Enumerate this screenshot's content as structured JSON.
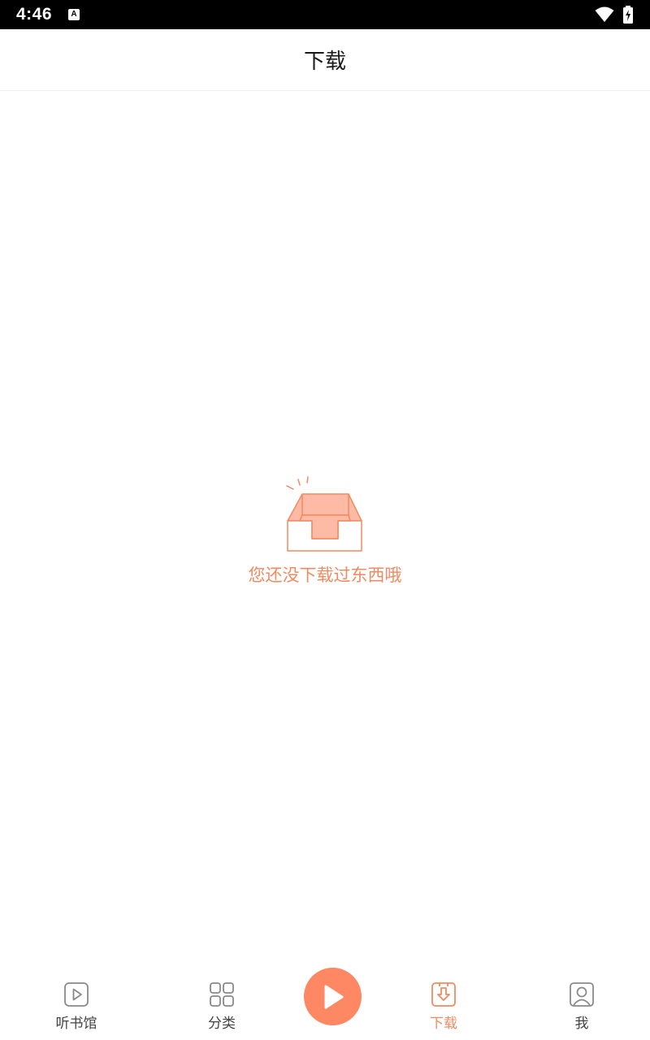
{
  "status_bar": {
    "time": "4:46",
    "notification_glyph": "A",
    "icons": [
      "wifi-icon",
      "battery-charging-icon"
    ]
  },
  "app_bar": {
    "title": "下载"
  },
  "empty_state": {
    "icon": "empty-inbox-icon",
    "message": "您还没下载过东西哦"
  },
  "bottom_nav": {
    "items": [
      {
        "label": "听书馆",
        "icon": "play-square-icon",
        "active": false
      },
      {
        "label": "分类",
        "icon": "grid-icon",
        "active": false
      },
      {
        "label": "下载",
        "icon": "download-icon",
        "active": true
      },
      {
        "label": "我",
        "icon": "profile-icon",
        "active": false
      }
    ],
    "center_button_icon": "play-icon"
  },
  "colors": {
    "accent": "#f08a62",
    "fab": "#fd8863",
    "inbox_fill": "#fdbaa5",
    "status_bar_bg": "#000000",
    "text_primary": "#1a1a1a",
    "text_secondary": "#444444"
  }
}
